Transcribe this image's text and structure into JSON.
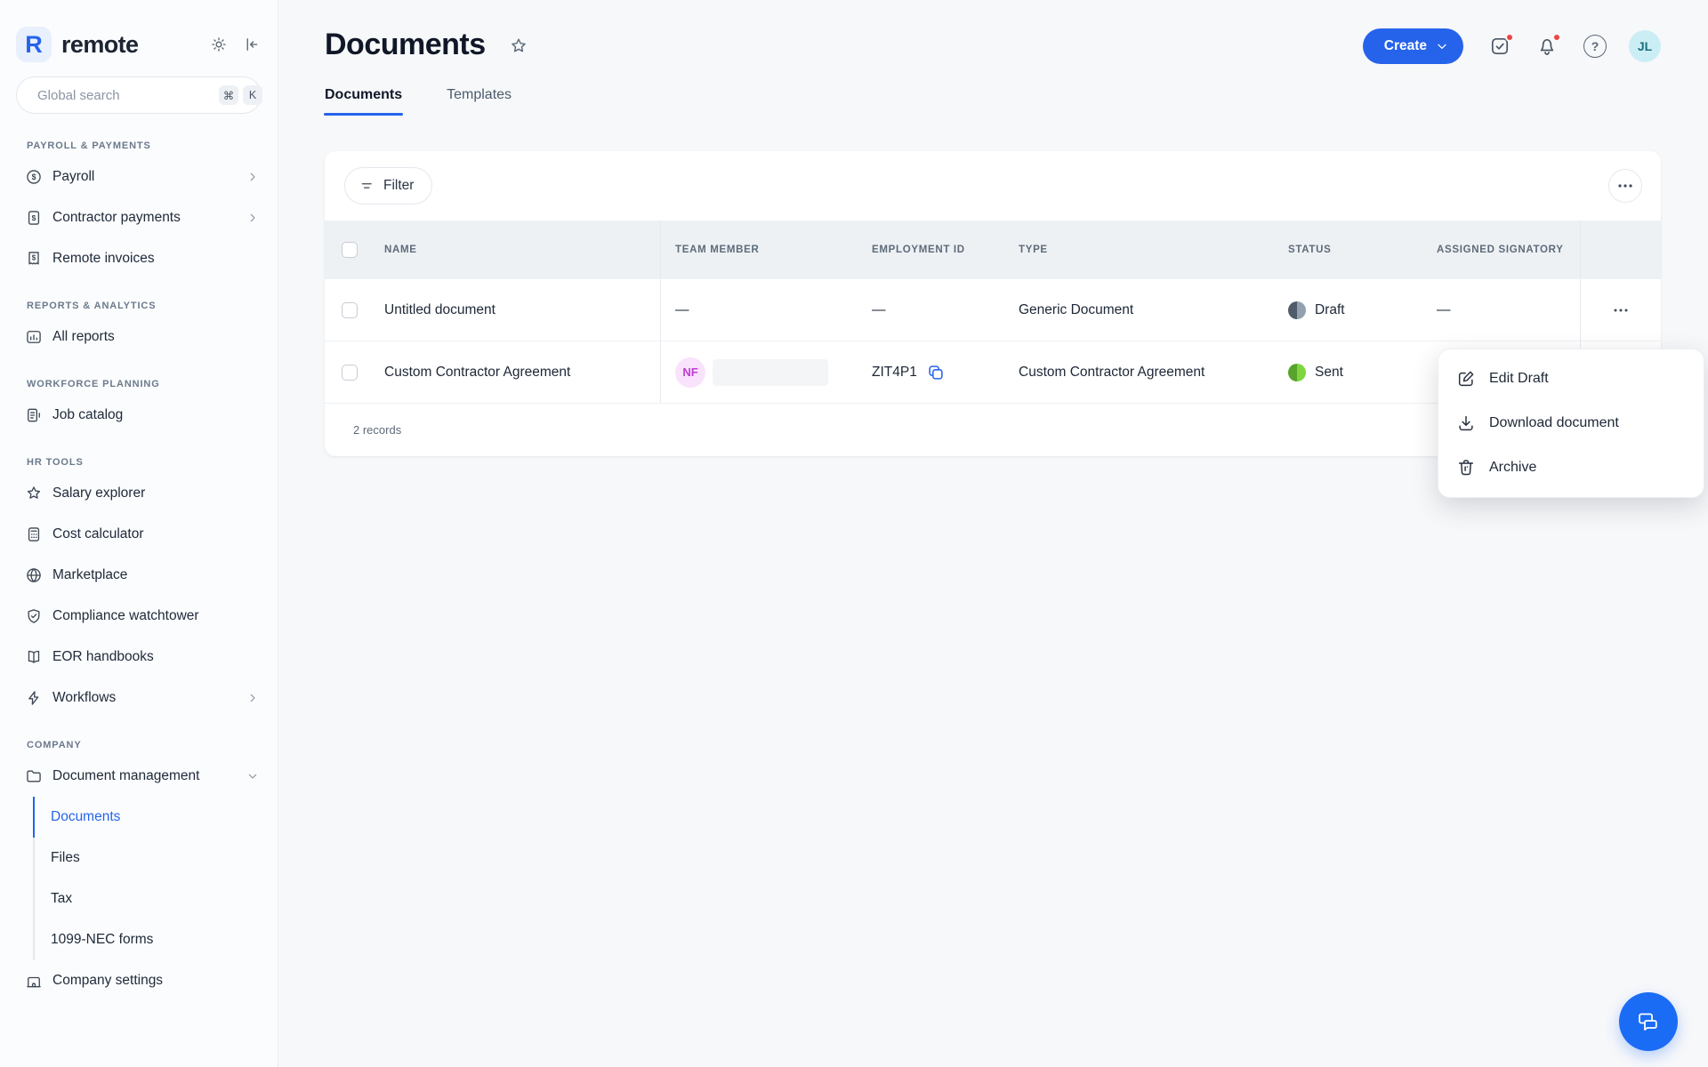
{
  "brand": {
    "wordmark": "remote",
    "logo_letter": "R"
  },
  "search": {
    "placeholder": "Global search",
    "key1": "⌘",
    "key2": "K"
  },
  "sidebar": {
    "sections": [
      {
        "label": "PAYROLL & PAYMENTS",
        "items": [
          {
            "label": "Payroll"
          },
          {
            "label": "Contractor payments"
          },
          {
            "label": "Remote invoices"
          }
        ]
      },
      {
        "label": "REPORTS & ANALYTICS",
        "items": [
          {
            "label": "All reports"
          }
        ]
      },
      {
        "label": "WORKFORCE PLANNING",
        "items": [
          {
            "label": "Job catalog"
          }
        ]
      },
      {
        "label": "HR TOOLS",
        "items": [
          {
            "label": "Salary explorer"
          },
          {
            "label": "Cost calculator"
          },
          {
            "label": "Marketplace"
          },
          {
            "label": "Compliance watchtower"
          },
          {
            "label": "EOR handbooks"
          },
          {
            "label": "Workflows"
          }
        ]
      },
      {
        "label": "COMPANY",
        "items": [
          {
            "label": "Document management",
            "children": [
              {
                "label": "Documents"
              },
              {
                "label": "Files"
              },
              {
                "label": "Tax"
              },
              {
                "label": "1099-NEC forms"
              }
            ]
          },
          {
            "label": "Company settings"
          }
        ]
      }
    ]
  },
  "header": {
    "title": "Documents",
    "create_label": "Create",
    "help_glyph": "?",
    "avatar_initials": "JL",
    "tabs": [
      {
        "label": "Documents"
      },
      {
        "label": "Templates"
      }
    ]
  },
  "toolbar": {
    "filter_label": "Filter"
  },
  "table": {
    "columns": {
      "name": "NAME",
      "team_member": "TEAM MEMBER",
      "employment_id": "EMPLOYMENT ID",
      "type": "TYPE",
      "status": "STATUS",
      "assigned_signatory": "ASSIGNED SIGNATORY"
    },
    "rows": [
      {
        "name": "Untitled document",
        "team_member": "—",
        "employment_id": "—",
        "type": "Generic Document",
        "status": "Draft",
        "signatory": "—"
      },
      {
        "name": "Custom Contractor Agreement",
        "team_member_initials": "NF",
        "employment_id": "ZIT4P1",
        "type": "Custom Contractor Agreement",
        "status": "Sent",
        "signatory": ""
      }
    ],
    "footer": "2 records"
  },
  "context_menu": {
    "items": [
      {
        "label": "Edit Draft"
      },
      {
        "label": "Download document"
      },
      {
        "label": "Archive"
      }
    ]
  },
  "colors": {
    "accent": "#2563eb",
    "draft_left": "#4e5b6b",
    "draft_right": "#93a0ae",
    "sent_left": "#57a32b",
    "sent_right": "#7fd53e",
    "notification": "#ef4444"
  }
}
